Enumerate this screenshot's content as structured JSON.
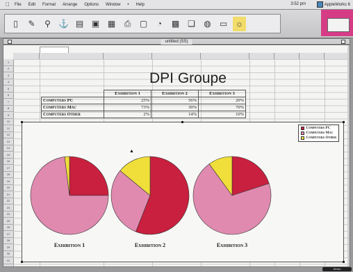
{
  "menubar": {
    "apple": "",
    "items": [
      "File",
      "Edit",
      "Format",
      "Arrange",
      "Options",
      "Window",
      "•",
      "Help"
    ],
    "clock": "3:52 pm",
    "app": "AppleWorks 6"
  },
  "toolbar": {
    "buttons": [
      "page-icon",
      "pencil-icon",
      "stamp-icon",
      "anchor-icon",
      "paste-icon",
      "frame-icon",
      "table-icon",
      "print-icon",
      "doc-icon",
      "pie-icon",
      "calendar-icon",
      "copy-icon",
      "globe-icon",
      "movie-icon",
      "lightbulb-icon"
    ]
  },
  "window": {
    "title": "untitled (SS)"
  },
  "sheet": {
    "title": "DPI Groupe",
    "headers": [
      "Exhibition 1",
      "Exhibition 2",
      "Exhibition 3"
    ],
    "rows": [
      {
        "label": "Computers PC",
        "values": [
          "25%",
          "56%",
          "20%"
        ]
      },
      {
        "label": "Computers Mac",
        "values": [
          "73%",
          "30%",
          "70%"
        ]
      },
      {
        "label": "Computers Other",
        "values": [
          "2%",
          "14%",
          "10%"
        ]
      }
    ]
  },
  "colors": {
    "pc": "#c8203e",
    "mac": "#e08ab0",
    "other": "#f0de3a"
  },
  "chart_data": {
    "type": "pie",
    "series_names": [
      "Computers PC",
      "Computers Mac",
      "Computers Other"
    ],
    "pies": [
      {
        "label": "Exhibition 1",
        "values": [
          25,
          73,
          2
        ]
      },
      {
        "label": "Exhibition 2",
        "values": [
          56,
          30,
          14
        ]
      },
      {
        "label": "Exhibition 3",
        "values": [
          20,
          70,
          10
        ]
      }
    ],
    "legend_position": "top-right"
  },
  "dock_label": "Demo"
}
